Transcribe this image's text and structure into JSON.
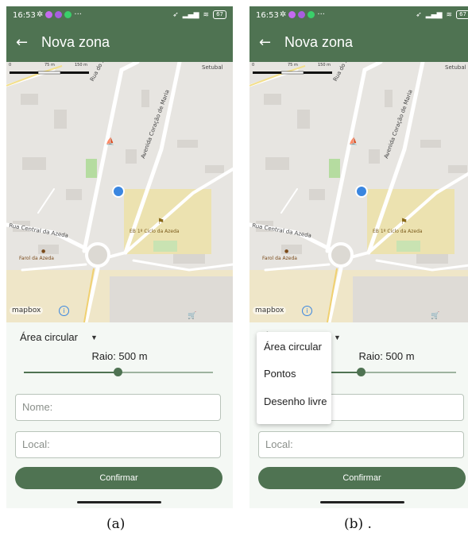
{
  "status_bar": {
    "time": "16:53",
    "more": "···",
    "battery": "67"
  },
  "app_bar": {
    "back_icon": "←",
    "title": "Nova zona"
  },
  "map": {
    "scale_labels": [
      "0",
      "75 m",
      "150 m"
    ],
    "street_labels": [
      "Rua do Xarafe",
      "Avenida Coração de Maria",
      "Rua Central da Azeda",
      "Setubal"
    ],
    "poi_labels": [
      "EB 1º Ciclo da Azeda",
      "Farol da Azeda"
    ],
    "attribution": "mapbox",
    "info_icon": "i",
    "colors": {
      "map_bg": "#e7e5e1",
      "road": "#ffffff",
      "school_area": "#ece2b0",
      "park": "#b5dca0",
      "location_dot": "#3a86e0"
    }
  },
  "form": {
    "zone_type_selected": "Área circular",
    "radius_label": "Raio: 500 m",
    "slider_value_fraction": 0.5,
    "name_placeholder": "Nome:",
    "local_placeholder": "Local:",
    "confirm_label": "Confirmar"
  },
  "dropdown_menu": {
    "items": [
      "Área circular",
      "Pontos",
      "Desenho livre"
    ]
  },
  "captions": {
    "a": "(a)",
    "b": "(b) ."
  },
  "colors": {
    "primary": "#4f7352",
    "surface": "#f4f8f4"
  }
}
